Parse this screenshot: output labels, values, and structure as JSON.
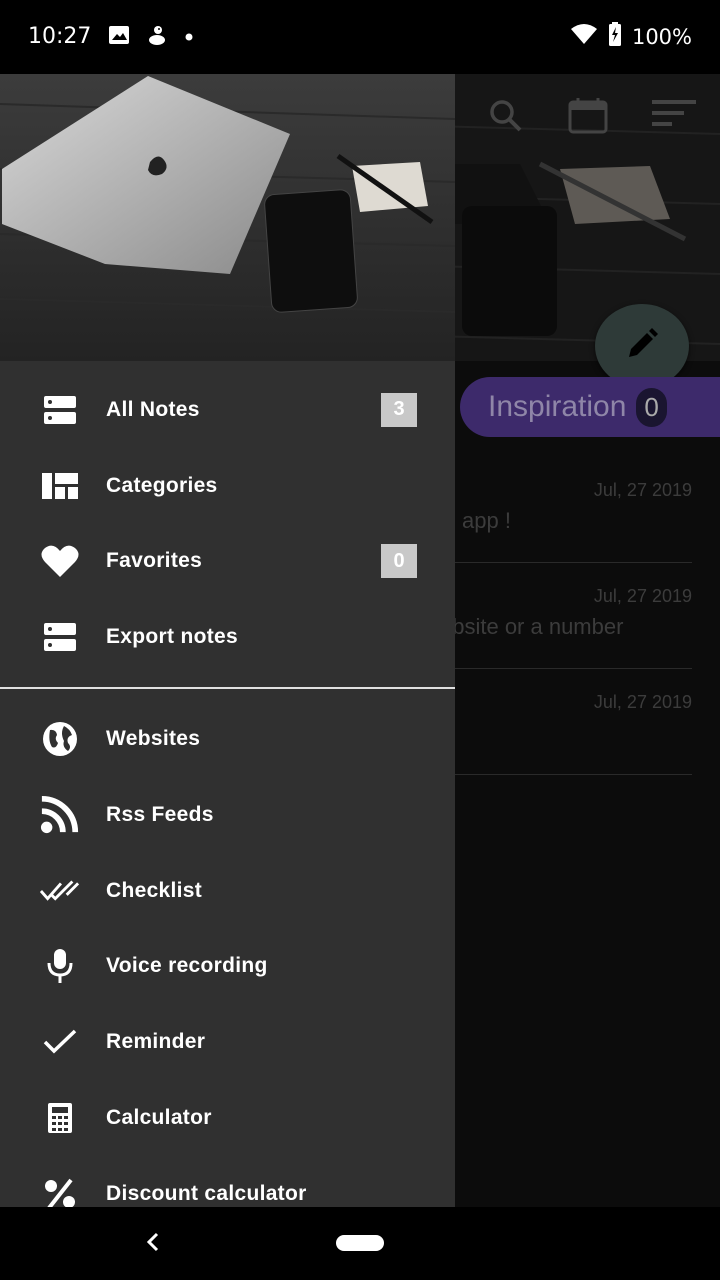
{
  "status_bar": {
    "time": "10:27",
    "battery": "100%",
    "icons_left": [
      "image-icon",
      "duck-icon",
      "dot-icon"
    ],
    "icons_right": [
      "wifi-icon",
      "battery-icon"
    ]
  },
  "background": {
    "toolbar_icons": [
      "search-icon",
      "calendar-icon",
      "sort-icon"
    ],
    "fab_icon": "pencil-icon",
    "chip": {
      "label": "Inspiration",
      "count": "0"
    },
    "notes": [
      {
        "date": "Jul, 27 2019",
        "text": "app !"
      },
      {
        "date": "Jul, 27 2019",
        "text": "ebsite or a number"
      },
      {
        "date": "Jul, 27 2019",
        "text": ""
      }
    ]
  },
  "drawer": {
    "section1": [
      {
        "label": "All Notes",
        "icon": "notes-icon",
        "badge": "3"
      },
      {
        "label": "Categories",
        "icon": "categories-icon"
      },
      {
        "label": "Favorites",
        "icon": "heart-icon",
        "badge": "0"
      },
      {
        "label": "Export notes",
        "icon": "export-icon"
      }
    ],
    "section2": [
      {
        "label": "Websites",
        "icon": "globe-icon"
      },
      {
        "label": "Rss Feeds",
        "icon": "rss-icon"
      },
      {
        "label": "Checklist",
        "icon": "double-check-icon"
      },
      {
        "label": "Voice recording",
        "icon": "microphone-icon"
      },
      {
        "label": "Reminder",
        "icon": "check-icon"
      },
      {
        "label": "Calculator",
        "icon": "calculator-icon"
      },
      {
        "label": "Discount calculator",
        "icon": "percent-icon"
      }
    ]
  },
  "colors": {
    "drawer_bg": "#303030",
    "badge_bg": "#c8c8c8",
    "chip_bg": "#3d2a6b"
  }
}
